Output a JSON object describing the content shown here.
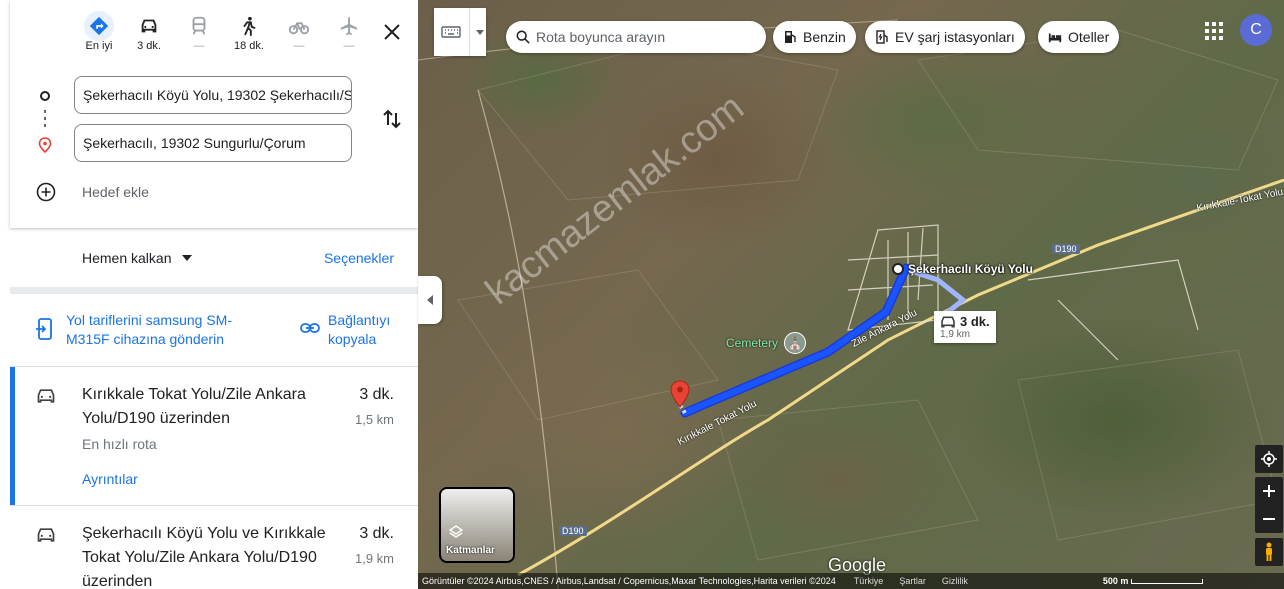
{
  "modes": [
    {
      "label": "En iyi",
      "icon": "directions-icon"
    },
    {
      "label": "3 dk.",
      "icon": "car-icon"
    },
    {
      "label": "—",
      "icon": "transit-icon"
    },
    {
      "label": "18 dk.",
      "icon": "walk-icon"
    },
    {
      "label": "—",
      "icon": "bicycle-icon"
    },
    {
      "label": "—",
      "icon": "flight-icon"
    }
  ],
  "origin": "Şekerhacılı Köyü Yolu, 19302 Şekerhacılı/S",
  "destination": "Şekerhacılı, 19302 Sungurlu/Çorum",
  "add_destination": "Hedef ekle",
  "depart": "Hemen kalkan",
  "options": "Seçenekler",
  "send_line1": "Yol tariflerini samsung SM-",
  "send_line2": "M315F cihazına gönderin",
  "copy_line1": "Bağlantıyı",
  "copy_line2": "kopyala",
  "routes": [
    {
      "title_line1": "Kırıkkale Tokat Yolu/Zile Ankara",
      "title_line2": "Yolu/D190 üzerinden",
      "time": "3 dk.",
      "distance": "1,5 km",
      "subtitle": "En hızlı rota",
      "details": "Ayrıntılar"
    },
    {
      "title_line1": "Şekerhacılı Köyü Yolu ve Kırıkkale",
      "title_line2": "Tokat Yolu/Zile Ankara Yolu/D190",
      "title_line3": "üzerinden",
      "time": "3 dk.",
      "distance": "1,9 km"
    }
  ],
  "map": {
    "search_placeholder": "Rota boyunca arayın",
    "chips": [
      "Benzin",
      "EV şarj istasyonları",
      "Oteller"
    ],
    "avatar": "C",
    "place_label": "Şekerhacılı Köyü Yolu",
    "cemetery": "Cemetery",
    "road1": "Kırıkkale-Tokat Yolu",
    "road1b": "Kırıkkale Tokat Yolu",
    "road2": "Zile Ankara Yolu",
    "d190": "D190",
    "route_time": "3 dk.",
    "route_km": "1,9 km",
    "watermark": "kacmazemlak.com",
    "layers": "Katmanlar",
    "google": "Google",
    "attribution": "Görüntüler ©2024 Airbus,CNES / Airbus,Landsat / Copernicus,Maxar Technologies,Harita verileri ©2024",
    "turkiye": "Türkiye",
    "terms": "Şartlar",
    "privacy": "Gizlilik",
    "scale": "500 m"
  },
  "colors": {
    "accent": "#1a73e8",
    "route": "#1a54ff",
    "pin": "#ea4335"
  }
}
